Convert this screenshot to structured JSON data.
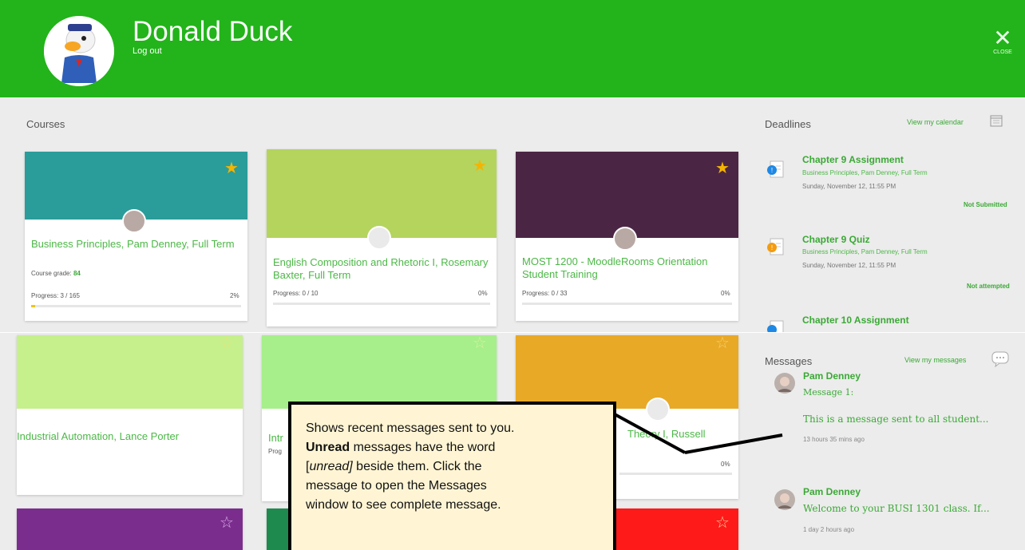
{
  "header": {
    "user_name": "Donald Duck",
    "logout_label": "Log out",
    "close_label": "CLOSE"
  },
  "courses_section": {
    "title": "Courses"
  },
  "courses": [
    {
      "title": "Business Principles, Pam Denney, Full Term",
      "grade_label": "Course grade:",
      "grade_value": "84",
      "progress_label": "Progress: 3 / 165",
      "progress_pct": "2%",
      "progress_fraction": 0.02,
      "color": "#2a9d9a",
      "starred": true
    },
    {
      "title": "English Composition and Rhetoric I, Rosemary Baxter, Full Term",
      "progress_label": "Progress: 0 / 10",
      "progress_pct": "0%",
      "progress_fraction": 0,
      "color": "#b4d45e",
      "starred": true
    },
    {
      "title": "MOST 1200 - MoodleRooms Orientation Student Training",
      "progress_label": "Progress: 0 / 33",
      "progress_pct": "0%",
      "progress_fraction": 0,
      "color": "#4b2644",
      "starred": true
    },
    {
      "title": "Industrial Automation, Lance Porter",
      "color": "#c5f08c",
      "starred": false
    },
    {
      "title": "Intr",
      "progress_label": "Prog",
      "color": "#a6ef8a",
      "starred": false
    },
    {
      "title": "Theory I, Russell",
      "progress_pct": "0%",
      "color": "#e8a926",
      "starred": false
    },
    {
      "color": "#7b2d8e",
      "starred": false
    },
    {
      "color": "#1e8a4e",
      "starred": false
    },
    {
      "color": "#ff1a1a",
      "starred": false
    }
  ],
  "deadlines": {
    "title": "Deadlines",
    "calendar_link": "View my calendar",
    "items": [
      {
        "title": "Chapter 9 Assignment",
        "course": "Business Principles, Pam Denney, Full Term",
        "date": "Sunday, November 12, 11:55 PM",
        "status": "Not Submitted",
        "icon": "assignment-icon"
      },
      {
        "title": "Chapter 9 Quiz",
        "course": "Business Principles, Pam Denney, Full Term",
        "date": "Sunday, November 12, 11:55 PM",
        "status": "Not attempted",
        "icon": "quiz-icon"
      },
      {
        "title": "Chapter 10 Assignment",
        "icon": "assignment-icon"
      }
    ]
  },
  "messages": {
    "title": "Messages",
    "view_link": "View my messages",
    "items": [
      {
        "sender": "Pam Denney",
        "subject": "Message 1:",
        "body": "This is a message sent to all student...",
        "time": "13 hours 35 mins ago"
      },
      {
        "sender": "Pam Denney",
        "body": "Welcome to your BUSI 1301 class. If...",
        "time": "1 day 2 hours ago"
      }
    ]
  },
  "callout": {
    "line1": "Shows recent messages sent to you.",
    "unread_bold": "Unread",
    "line2_rest": " messages have the word",
    "bracket_open": "[",
    "unread_italic": "unread]",
    "line3_rest": " beside them. Click the",
    "line4": "message to open the Messages",
    "line5": "window to see complete message."
  },
  "colors": {
    "header_green": "#22b41a",
    "link_green": "#3aa935",
    "star_gold": "#f5b400"
  }
}
